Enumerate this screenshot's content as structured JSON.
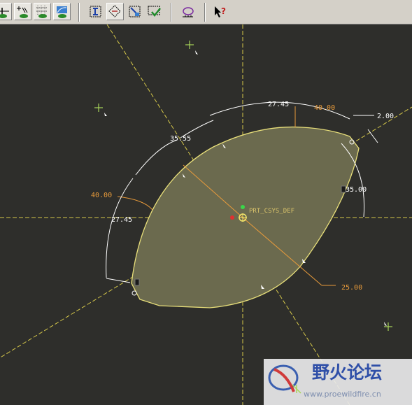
{
  "toolbar": {
    "buttons": [
      {
        "name": "dimension-display-button",
        "icon": "dimension-toggle-icon"
      },
      {
        "name": "constraint-display-button",
        "icon": "constraint-toggle-icon"
      },
      {
        "name": "grid-display-button",
        "icon": "grid-toggle-icon"
      },
      {
        "name": "vertex-display-button",
        "icon": "vertex-toggle-icon"
      },
      {
        "name": "sketch-orient-button",
        "icon": "sketch-orient-icon"
      },
      {
        "name": "datum-plane-display-button",
        "icon": "datum-plane-icon"
      },
      {
        "name": "datum-csys-display-button",
        "icon": "datum-csys-icon"
      },
      {
        "name": "sketch-verify-button",
        "icon": "sketch-check-icon"
      },
      {
        "name": "sketch-diagnostic-button",
        "icon": "sketch-analyze-icon"
      },
      {
        "name": "whats-this-help-button",
        "icon": "whats-this-help-icon"
      }
    ]
  },
  "sketch": {
    "csys_label": "PRT_CSYS_DEF",
    "dims": {
      "d1": "27.45",
      "d2": "40.00",
      "d3": "2.00",
      "d4": "35.55",
      "d5": "40.00",
      "d6": "35.00",
      "d7": "27.45",
      "d8": "25.00"
    },
    "colors": {
      "background": "#2e2e2b",
      "centerline": "#d6c84a",
      "fill": "#6b6a4e",
      "edge": "#e8df7a",
      "dimension": "#ffffff",
      "driving_dim": "#e89b3b"
    }
  },
  "watermark": {
    "title": "野火论坛",
    "url": "www.proewildfire.cn"
  }
}
